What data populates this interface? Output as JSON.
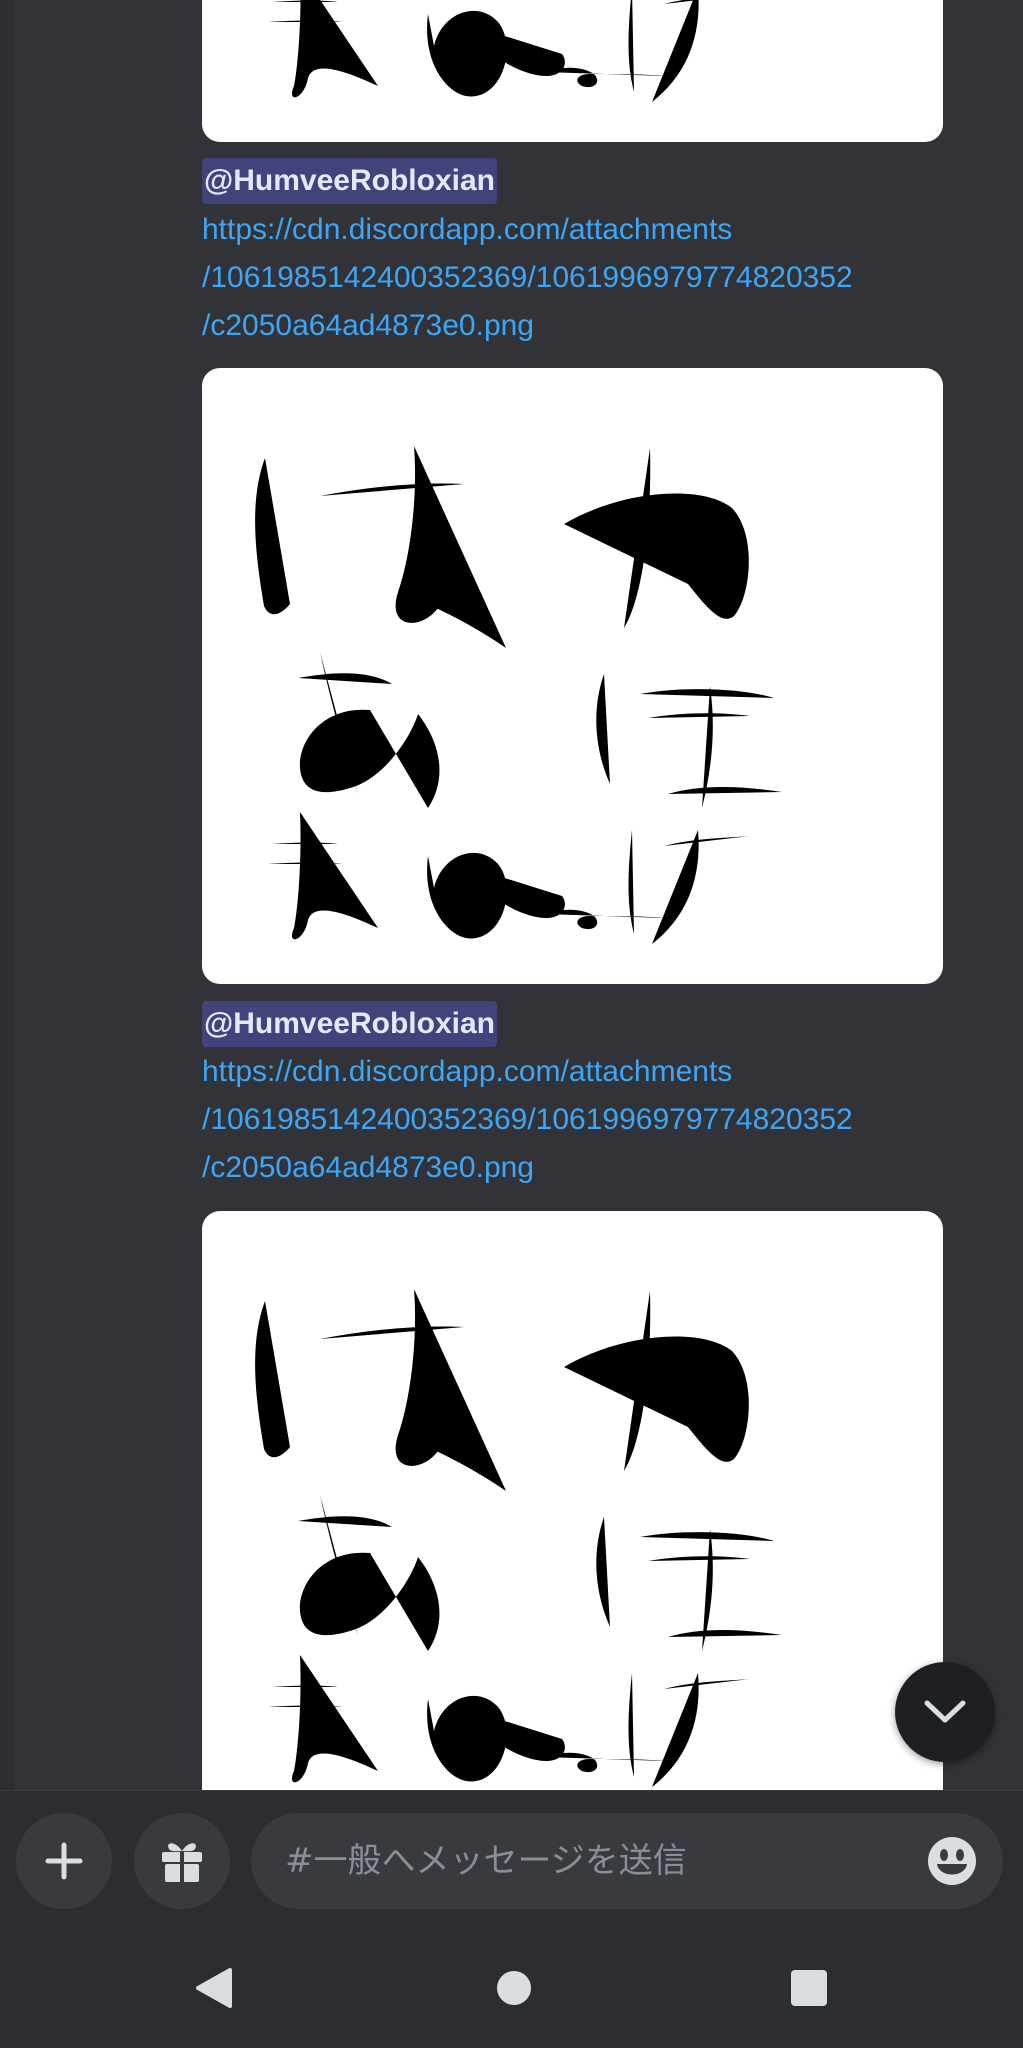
{
  "messages": [
    {
      "mention": "@HumveeRobloxian",
      "link_lines": [
        "https://cdn.discordapp.com/attachments",
        "/1061985142400352369/1061996979774820352",
        "/c2050a64ad4873e0.png"
      ]
    },
    {
      "mention": "@HumveeRobloxian",
      "link_lines": [
        "https://cdn.discordapp.com/attachments",
        "/1061985142400352369/1061996979774820352",
        "/c2050a64ad4873e0.png"
      ]
    }
  ],
  "composer": {
    "placeholder": "#一般へメッセージを送信",
    "add_icon": "plus-icon",
    "gift_icon": "gift-icon",
    "emoji_icon": "emoji-icon"
  },
  "scroll_button_icon": "chevron-down-icon",
  "navbar": {
    "icons": [
      "back-triangle-icon",
      "home-circle-icon",
      "recents-square-icon"
    ]
  }
}
